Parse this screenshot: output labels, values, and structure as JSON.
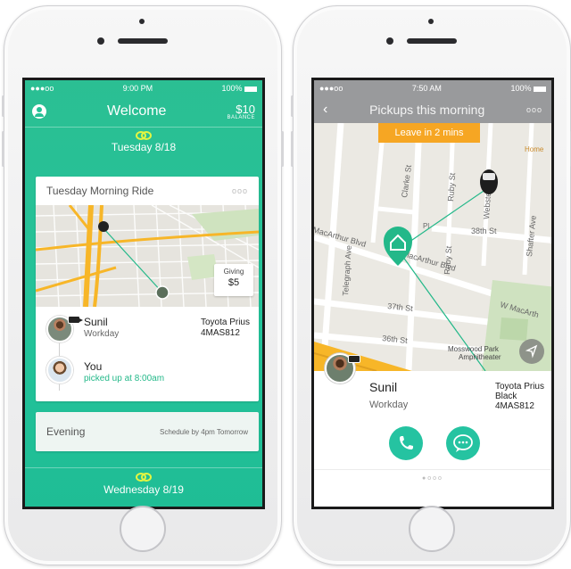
{
  "left_phone": {
    "status": {
      "signal": "●●●oo",
      "wifi": "wifi-icon",
      "time": "9:00 PM",
      "battery": "100%"
    },
    "header": {
      "title": "Welcome",
      "balance_amount": "$10",
      "balance_label": "BALANCE"
    },
    "day1": "Tuesday 8/18",
    "ride_card": {
      "title": "Tuesday Morning Ride",
      "more": "ooo",
      "giving_label": "Giving",
      "giving_amount": "$5",
      "driver": {
        "name": "Sunil",
        "sub": "Workday",
        "car_model": "Toyota Prius",
        "plate": "4MAS812"
      },
      "rider": {
        "name": "You",
        "sub": "picked up at 8:00am"
      }
    },
    "evening_card": {
      "title": "Evening",
      "sub": "Schedule by 4pm Tomorrow"
    },
    "day2": "Wednesday 8/19"
  },
  "right_phone": {
    "status": {
      "signal": "●●●oo",
      "wifi": "wifi-icon",
      "time": "7:50 AM",
      "battery": "100%"
    },
    "header": {
      "back": "‹",
      "title": "Pickups this morning",
      "more": "ooo"
    },
    "leave_pill": "Leave in 2 mins",
    "map_labels": {
      "home": "Home",
      "clarke": "Clarke St",
      "ruby1": "Ruby St",
      "webster": "Webster",
      "shafter": "Shafter Ave",
      "macarthur_l": "MacArthur Blvd",
      "telegraph": "Telegraph Ave",
      "w_macarthur": "W MacArthur Blvd",
      "ruby2": "Ruby St",
      "st38": "38th St",
      "st37": "37th St",
      "st36": "36th St",
      "w_macarth2": "W MacArth",
      "mosswood": "Mosswood Park",
      "amphitheater": "Amphitheater",
      "pl": "Pl"
    },
    "driver": {
      "name": "Sunil",
      "sub": "Workday",
      "car_model": "Toyota Prius",
      "car_color": "Black",
      "plate": "4MAS812"
    },
    "pager": "●ooo"
  },
  "colors": {
    "teal": "#22c39a",
    "orange": "#f6a623",
    "highway": "#f7b628",
    "lime": "#e3f542"
  }
}
